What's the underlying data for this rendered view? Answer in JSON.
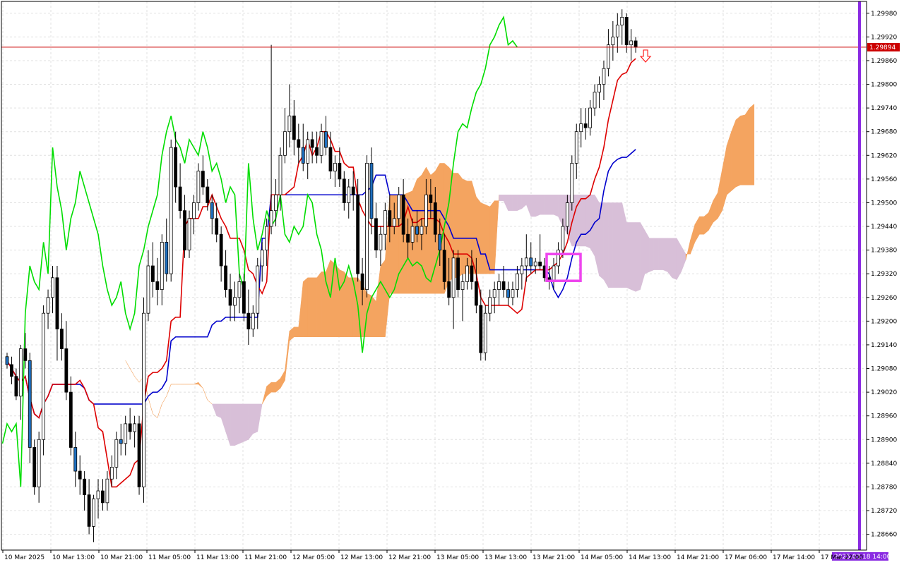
{
  "chart_data": {
    "type": "candlestick",
    "instrument_note": "",
    "title": "",
    "ylim": [
      1.2862,
      1.3001
    ],
    "y_ticks": [
      "1.29980",
      "1.29920",
      "1.29860",
      "1.29800",
      "1.29740",
      "1.29680",
      "1.29620",
      "1.29560",
      "1.29500",
      "1.29440",
      "1.29380",
      "1.29320",
      "1.29260",
      "1.29200",
      "1.29140",
      "1.29080",
      "1.29020",
      "1.28960",
      "1.28900",
      "1.28840",
      "1.28780",
      "1.28720",
      "1.28660"
    ],
    "x_ticks": [
      "10 Mar 2025",
      "10 Mar 13:00",
      "10 Mar 21:00",
      "11 Mar 05:00",
      "11 Mar 13:00",
      "11 Mar 21:00",
      "12 Mar 05:00",
      "12 Mar 13:00",
      "12 Mar 21:00",
      "13 Mar 05:00",
      "13 Mar 13:00",
      "13 Mar 21:00",
      "14 Mar 05:00",
      "14 Mar 13:00",
      "14 Mar 21:00",
      "17 Mar 06:00",
      "17 Mar 14:00",
      "17 Mar 22:00"
    ],
    "current_price": {
      "label": "1.29894",
      "value": 1.29894,
      "color": "#cc0000"
    },
    "time_marker": {
      "label": "2025.03.18 14:00",
      "color": "#8a2be2"
    },
    "colors": {
      "bull_candle": "#ffffff",
      "bear_candle": "#000000",
      "blue_candle": "#1f6fbf",
      "tenkan": "#dd0000",
      "kijun": "#0000cc",
      "chikou": "#00dd00",
      "kumo_bull": "#f4a460",
      "kumo_bear": "#d8bfd8",
      "highlight_box": "#ee44ee",
      "grid": "#e0e0e0",
      "axis": "#000000"
    },
    "candles": [
      [
        1.2911,
        1.2912,
        1.2908,
        1.2909
      ],
      [
        1.2909,
        1.2911,
        1.2904,
        1.2906
      ],
      [
        1.2906,
        1.2908,
        1.29,
        1.2901
      ],
      [
        1.2901,
        1.2914,
        1.2895,
        1.2913
      ],
      [
        1.2913,
        1.2917,
        1.2908,
        1.291
      ],
      [
        1.291,
        1.2912,
        1.2884,
        1.2888
      ],
      [
        1.2888,
        1.289,
        1.2876,
        1.2878
      ],
      [
        1.2878,
        1.2892,
        1.2874,
        1.289
      ],
      [
        1.289,
        1.2924,
        1.2886,
        1.2922
      ],
      [
        1.2922,
        1.2928,
        1.2918,
        1.2926
      ],
      [
        1.2926,
        1.2934,
        1.2922,
        1.2931
      ],
      [
        1.2931,
        1.2934,
        1.291,
        1.2918
      ],
      [
        1.2918,
        1.2922,
        1.291,
        1.2913
      ],
      [
        1.2913,
        1.292,
        1.29,
        1.2902
      ],
      [
        1.2902,
        1.2906,
        1.2886,
        1.2888
      ],
      [
        1.2888,
        1.2892,
        1.2878,
        1.2882
      ],
      [
        1.2882,
        1.2886,
        1.2876,
        1.288
      ],
      [
        1.288,
        1.2882,
        1.2872,
        1.2876
      ],
      [
        1.2876,
        1.288,
        1.2866,
        1.2868
      ],
      [
        1.2868,
        1.2876,
        1.2864,
        1.2875
      ],
      [
        1.2875,
        1.288,
        1.287,
        1.2877
      ],
      [
        1.2877,
        1.288,
        1.2872,
        1.2874
      ],
      [
        1.2874,
        1.2882,
        1.2872,
        1.288
      ],
      [
        1.288,
        1.2886,
        1.2878,
        1.2883
      ],
      [
        1.2883,
        1.2892,
        1.288,
        1.289
      ],
      [
        1.289,
        1.2894,
        1.2886,
        1.2889
      ],
      [
        1.2889,
        1.2896,
        1.2886,
        1.2894
      ],
      [
        1.2894,
        1.2898,
        1.289,
        1.2892
      ],
      [
        1.2892,
        1.2896,
        1.2888,
        1.2894
      ],
      [
        1.2894,
        1.2896,
        1.2876,
        1.2878
      ],
      [
        1.2878,
        1.2926,
        1.2874,
        1.2922
      ],
      [
        1.2922,
        1.2938,
        1.292,
        1.2934
      ],
      [
        1.2934,
        1.294,
        1.2926,
        1.293
      ],
      [
        1.293,
        1.2936,
        1.2924,
        1.2928
      ],
      [
        1.2928,
        1.2942,
        1.2924,
        1.294
      ],
      [
        1.294,
        1.2946,
        1.293,
        1.2932
      ],
      [
        1.2932,
        1.2966,
        1.293,
        1.2964
      ],
      [
        1.2964,
        1.2968,
        1.295,
        1.2954
      ],
      [
        1.2954,
        1.296,
        1.2946,
        1.2948
      ],
      [
        1.2948,
        1.2952,
        1.2936,
        1.2938
      ],
      [
        1.2938,
        1.2948,
        1.2936,
        1.2946
      ],
      [
        1.2946,
        1.2952,
        1.2942,
        1.295
      ],
      [
        1.295,
        1.296,
        1.2948,
        1.2958
      ],
      [
        1.2958,
        1.2962,
        1.2952,
        1.2954
      ],
      [
        1.2954,
        1.2956,
        1.2948,
        1.295
      ],
      [
        1.295,
        1.2952,
        1.2942,
        1.2946
      ],
      [
        1.2946,
        1.295,
        1.294,
        1.2942
      ],
      [
        1.2942,
        1.2944,
        1.293,
        1.2934
      ],
      [
        1.2934,
        1.2938,
        1.2926,
        1.2928
      ],
      [
        1.2928,
        1.2932,
        1.292,
        1.2924
      ],
      [
        1.2924,
        1.293,
        1.292,
        1.2926
      ],
      [
        1.2926,
        1.2932,
        1.2922,
        1.293
      ],
      [
        1.293,
        1.2932,
        1.292,
        1.2922
      ],
      [
        1.2922,
        1.2928,
        1.2914,
        1.2918
      ],
      [
        1.2918,
        1.2924,
        1.2916,
        1.2922
      ],
      [
        1.2922,
        1.2936,
        1.2918,
        1.2934
      ],
      [
        1.2934,
        1.294,
        1.293,
        1.2938
      ],
      [
        1.2938,
        1.2946,
        1.2934,
        1.2944
      ],
      [
        1.2944,
        1.299,
        1.2942,
        1.2948
      ],
      [
        1.2948,
        1.2956,
        1.2944,
        1.2952
      ],
      [
        1.2952,
        1.2964,
        1.2948,
        1.2962
      ],
      [
        1.2962,
        1.2974,
        1.296,
        1.2968
      ],
      [
        1.2968,
        1.298,
        1.2964,
        1.2972
      ],
      [
        1.2972,
        1.2976,
        1.2962,
        1.2966
      ],
      [
        1.2966,
        1.297,
        1.296,
        1.2964
      ],
      [
        1.2964,
        1.297,
        1.2958,
        1.296
      ],
      [
        1.296,
        1.2968,
        1.2956,
        1.2966
      ],
      [
        1.2966,
        1.2968,
        1.296,
        1.2964
      ],
      [
        1.2964,
        1.2968,
        1.296,
        1.2962
      ],
      [
        1.2962,
        1.297,
        1.296,
        1.2968
      ],
      [
        1.2968,
        1.2972,
        1.2962,
        1.2964
      ],
      [
        1.2964,
        1.2968,
        1.2956,
        1.2958
      ],
      [
        1.2958,
        1.2962,
        1.2954,
        1.296
      ],
      [
        1.296,
        1.2964,
        1.2954,
        1.2956
      ],
      [
        1.2956,
        1.2958,
        1.2948,
        1.295
      ],
      [
        1.295,
        1.2956,
        1.2946,
        1.2954
      ],
      [
        1.2954,
        1.2958,
        1.2948,
        1.2952
      ],
      [
        1.2952,
        1.2956,
        1.293,
        1.2932
      ],
      [
        1.2932,
        1.2936,
        1.2924,
        1.2928
      ],
      [
        1.2928,
        1.2962,
        1.2926,
        1.296
      ],
      [
        1.296,
        1.2964,
        1.2942,
        1.2946
      ],
      [
        1.2946,
        1.295,
        1.2936,
        1.2938
      ],
      [
        1.2938,
        1.2944,
        1.2934,
        1.2942
      ],
      [
        1.2942,
        1.295,
        1.2938,
        1.2948
      ],
      [
        1.2948,
        1.2952,
        1.294,
        1.2944
      ],
      [
        1.2944,
        1.295,
        1.2942,
        1.2946
      ],
      [
        1.2946,
        1.2954,
        1.2944,
        1.2952
      ],
      [
        1.2952,
        1.2956,
        1.294,
        1.2942
      ],
      [
        1.2942,
        1.2946,
        1.2936,
        1.294
      ],
      [
        1.294,
        1.2946,
        1.2938,
        1.2944
      ],
      [
        1.2944,
        1.2948,
        1.294,
        1.2942
      ],
      [
        1.2942,
        1.2946,
        1.2938,
        1.2944
      ],
      [
        1.2944,
        1.2956,
        1.2942,
        1.2952
      ],
      [
        1.2952,
        1.2956,
        1.2946,
        1.295
      ],
      [
        1.295,
        1.2954,
        1.294,
        1.2942
      ],
      [
        1.2942,
        1.2946,
        1.2934,
        1.2938
      ],
      [
        1.2938,
        1.2942,
        1.2928,
        1.293
      ],
      [
        1.293,
        1.2936,
        1.2924,
        1.2926
      ],
      [
        1.2926,
        1.2938,
        1.2918,
        1.2936
      ],
      [
        1.2936,
        1.2938,
        1.2926,
        1.2928
      ],
      [
        1.2928,
        1.2932,
        1.292,
        1.293
      ],
      [
        1.293,
        1.2936,
        1.2928,
        1.2934
      ],
      [
        1.2934,
        1.2938,
        1.2928,
        1.293
      ],
      [
        1.293,
        1.2936,
        1.2922,
        1.2924
      ],
      [
        1.2924,
        1.2928,
        1.291,
        1.2912
      ],
      [
        1.2912,
        1.2924,
        1.291,
        1.2922
      ],
      [
        1.2922,
        1.2928,
        1.292,
        1.2926
      ],
      [
        1.2926,
        1.293,
        1.2922,
        1.2928
      ],
      [
        1.2928,
        1.2932,
        1.2924,
        1.293
      ],
      [
        1.293,
        1.2934,
        1.2926,
        1.2928
      ],
      [
        1.2928,
        1.293,
        1.2924,
        1.2926
      ],
      [
        1.2926,
        1.293,
        1.2924,
        1.2928
      ],
      [
        1.2928,
        1.2934,
        1.2926,
        1.2932
      ],
      [
        1.2932,
        1.2936,
        1.2928,
        1.2934
      ],
      [
        1.2934,
        1.2942,
        1.293,
        1.2936
      ],
      [
        1.2936,
        1.294,
        1.2932,
        1.2934
      ],
      [
        1.2934,
        1.2936,
        1.2932,
        1.2935
      ],
      [
        1.2935,
        1.2942,
        1.2933,
        1.2934
      ],
      [
        1.2934,
        1.2936,
        1.293,
        1.2931
      ],
      [
        1.2931,
        1.2934,
        1.2928,
        1.293
      ],
      [
        1.293,
        1.2936,
        1.2928,
        1.2934
      ],
      [
        1.2934,
        1.294,
        1.2932,
        1.2938
      ],
      [
        1.2938,
        1.2946,
        1.2936,
        1.2944
      ],
      [
        1.2944,
        1.2952,
        1.2942,
        1.295
      ],
      [
        1.295,
        1.2962,
        1.2948,
        1.296
      ],
      [
        1.296,
        1.297,
        1.2956,
        1.2968
      ],
      [
        1.2968,
        1.2974,
        1.2964,
        1.297
      ],
      [
        1.297,
        1.2974,
        1.2966,
        1.2969
      ],
      [
        1.2969,
        1.2976,
        1.2967,
        1.2974
      ],
      [
        1.2974,
        1.298,
        1.2972,
        1.2978
      ],
      [
        1.2978,
        1.2982,
        1.2974,
        1.298
      ],
      [
        1.298,
        1.2986,
        1.2976,
        1.2984
      ],
      [
        1.2984,
        1.2994,
        1.2982,
        1.299
      ],
      [
        1.299,
        1.2996,
        1.2986,
        1.2992
      ],
      [
        1.2992,
        1.2998,
        1.2988,
        1.2995
      ],
      [
        1.2995,
        1.2999,
        1.299,
        1.2997
      ],
      [
        1.2997,
        1.2998,
        1.2988,
        1.299
      ],
      [
        1.299,
        1.2994,
        1.2986,
        1.2991
      ],
      [
        1.2991,
        1.2992,
        1.2988,
        1.29894
      ]
    ]
  }
}
